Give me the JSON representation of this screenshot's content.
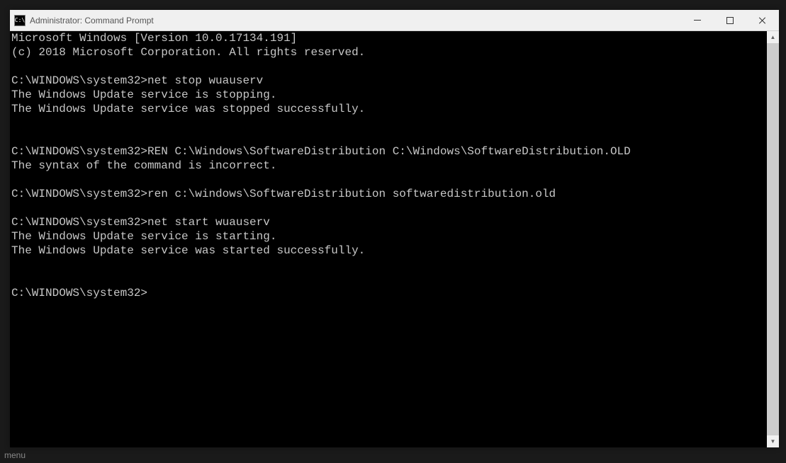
{
  "window": {
    "title": "Administrator: Command Prompt",
    "icon_label": "C:\\"
  },
  "terminal": {
    "lines": [
      "Microsoft Windows [Version 10.0.17134.191]",
      "(c) 2018 Microsoft Corporation. All rights reserved.",
      "",
      "C:\\WINDOWS\\system32>net stop wuauserv",
      "The Windows Update service is stopping.",
      "The Windows Update service was stopped successfully.",
      "",
      "",
      "C:\\WINDOWS\\system32>REN C:\\Windows\\SoftwareDistribution C:\\Windows\\SoftwareDistribution.OLD",
      "The syntax of the command is incorrect.",
      "",
      "C:\\WINDOWS\\system32>ren c:\\windows\\SoftwareDistribution softwaredistribution.old",
      "",
      "C:\\WINDOWS\\system32>net start wuauserv",
      "The Windows Update service is starting.",
      "The Windows Update service was started successfully.",
      "",
      "",
      "C:\\WINDOWS\\system32>"
    ]
  },
  "scrollbar": {
    "up_arrow": "▲",
    "down_arrow": "▼"
  },
  "background_fragment": "menu"
}
